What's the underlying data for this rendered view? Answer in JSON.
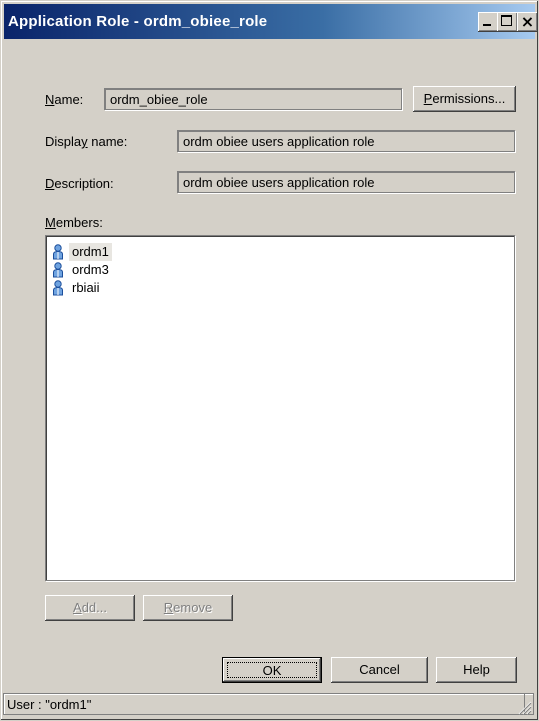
{
  "window": {
    "title": "Application Role - ordm_obiee_role"
  },
  "titlebar_buttons": {
    "minimize": "_",
    "maximize": "□",
    "close": "×"
  },
  "form": {
    "name_label_mn": "N",
    "name_label_rest": "ame:",
    "name_value": "ordm_obiee_role",
    "permissions_mn": "P",
    "permissions_rest": "ermissions...",
    "display_label_pre": "Displa",
    "display_label_mn": "y",
    "display_label_post": " name:",
    "display_value": "ordm obiee users application role",
    "description_label_mn": "D",
    "description_label_rest": "escription:",
    "description_value": "ordm obiee users application role",
    "members_label_mn": "M",
    "members_label_rest": "embers:"
  },
  "members": [
    {
      "name": "ordm1",
      "icon": "user-icon",
      "selected": true
    },
    {
      "name": "ordm3",
      "icon": "user-icon",
      "selected": false
    },
    {
      "name": "rbiaii",
      "icon": "user-icon",
      "selected": false
    }
  ],
  "buttons": {
    "add_mn": "A",
    "add_rest": "dd...",
    "remove_mn": "R",
    "remove_rest": "emove",
    "ok": "OK",
    "cancel": "Cancel",
    "help": "Help"
  },
  "status": {
    "text": "User : \"ordm1\""
  },
  "colors": {
    "title_start": "#0a246a",
    "title_end": "#a6caf0",
    "face": "#d4d0c8",
    "selection": "#e8e6e1"
  }
}
